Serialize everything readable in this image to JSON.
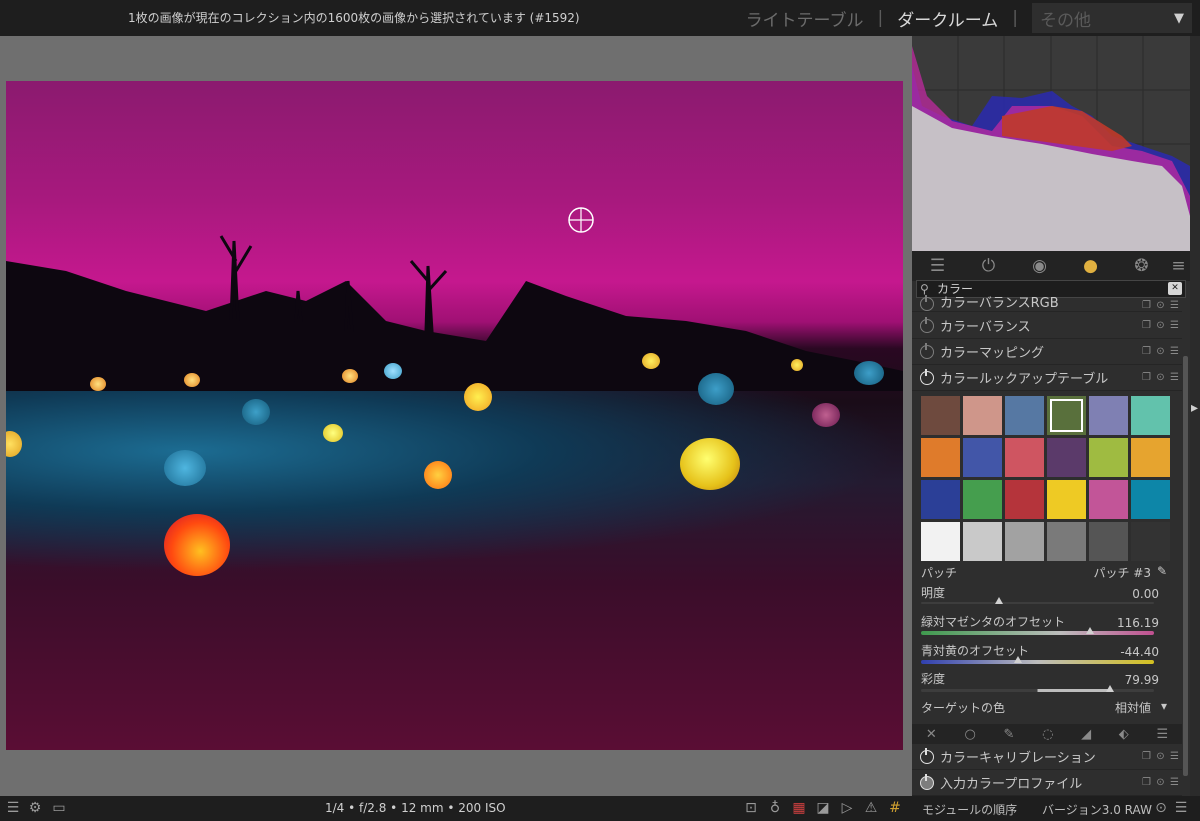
{
  "topbar": {
    "message": "1枚の画像が現在のコレクション内の1600枚の画像から選択されています (#1592)",
    "views": [
      "ライトテーブル",
      "ダークルーム",
      "その他"
    ],
    "separator": "|",
    "dropdown_arrow": "▼"
  },
  "bottombar": {
    "exif": "1/4 • f/2.8 • 12 mm • 200 ISO",
    "module_order_label": "モジュールの順序",
    "module_order_value": "バージョン3.0 RAW"
  },
  "right_panel": {
    "search_value": "カラー",
    "modules": [
      {
        "name": "カラーバランスRGB",
        "enabled": false
      },
      {
        "name": "カラーバランス",
        "enabled": false
      },
      {
        "name": "カラーマッピング",
        "enabled": false
      },
      {
        "name": "カラールックアップテーブル",
        "enabled": true
      },
      {
        "name": "カラーキャリブレーション",
        "enabled": true
      },
      {
        "name": "入力カラープロファイル",
        "enabled": true
      }
    ],
    "lut": {
      "patch_label": "パッチ",
      "patch_value": "パッチ #3",
      "lightness_label": "明度",
      "lightness_value": "0.00",
      "green_magenta_label": "緑対マゼンタのオフセット",
      "green_magenta_value": "116.19",
      "blue_yellow_label": "青対黄のオフセット",
      "blue_yellow_value": "-44.40",
      "saturation_label": "彩度",
      "saturation_value": "79.99",
      "target_label": "ターゲットの色",
      "target_value": "相対値",
      "target_arrow": "▾",
      "selected_patch_index": 3,
      "palette": [
        "#6e4a3e",
        "#cf968a",
        "#5678a3",
        "#59703c",
        "#7f80b3",
        "#62c2ac",
        "#df7b2b",
        "#4256a8",
        "#cf5561",
        "#5b3a6a",
        "#9fbb41",
        "#e6a42f",
        "#2b3f97",
        "#459e4e",
        "#b5343b",
        "#eeca24",
        "#c25598",
        "#0d86a8",
        "#f2f2f2",
        "#c9c9c9",
        "#a2a2a2",
        "#7a7a7a",
        "#555555",
        "#333333"
      ]
    }
  },
  "icons": {
    "search": "search-icon",
    "clear": "clear-search-icon",
    "picker": "color-picker-icon",
    "power": "power-icon"
  }
}
